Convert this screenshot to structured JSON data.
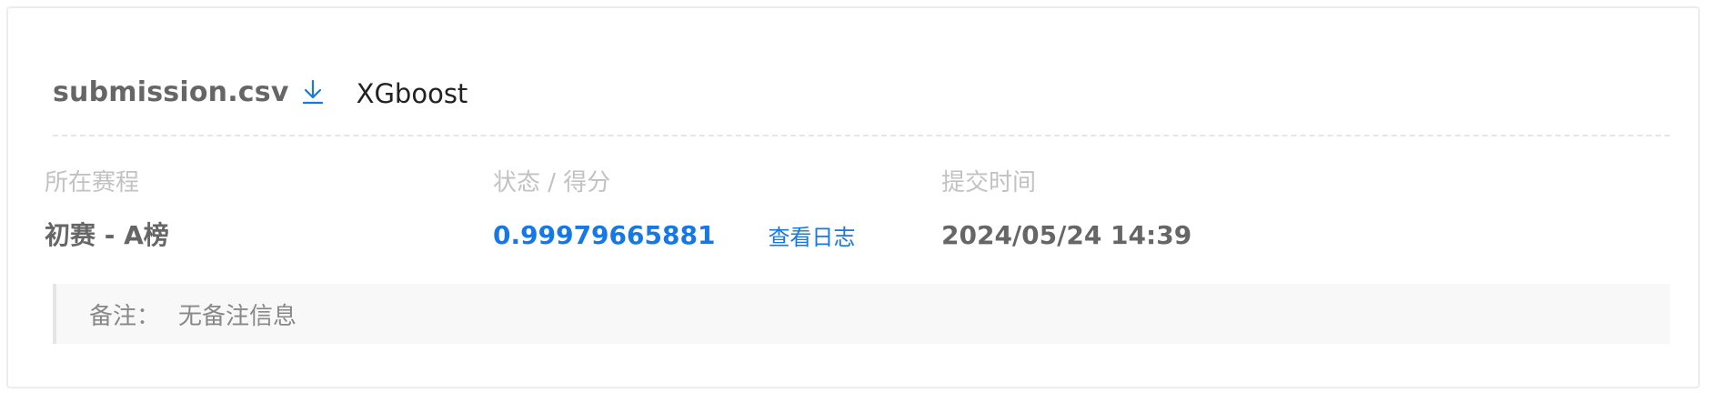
{
  "submission": {
    "filename": "submission.csv",
    "download_icon": "download-icon",
    "model_name": "XGboost"
  },
  "columns": {
    "stage": {
      "label": "所在赛程",
      "value": "初赛 - A榜"
    },
    "status": {
      "label": "状态 / 得分",
      "score": "0.99979665881",
      "log_link": "查看日志"
    },
    "time": {
      "label": "提交时间",
      "value": "2024/05/24 14:39"
    }
  },
  "note": {
    "label": "备注：",
    "text": "无备注信息"
  },
  "colors": {
    "accent": "#1677e6",
    "label_gray": "#c2c2c2",
    "value_gray": "#666666",
    "note_bg": "#f8f8f8"
  }
}
